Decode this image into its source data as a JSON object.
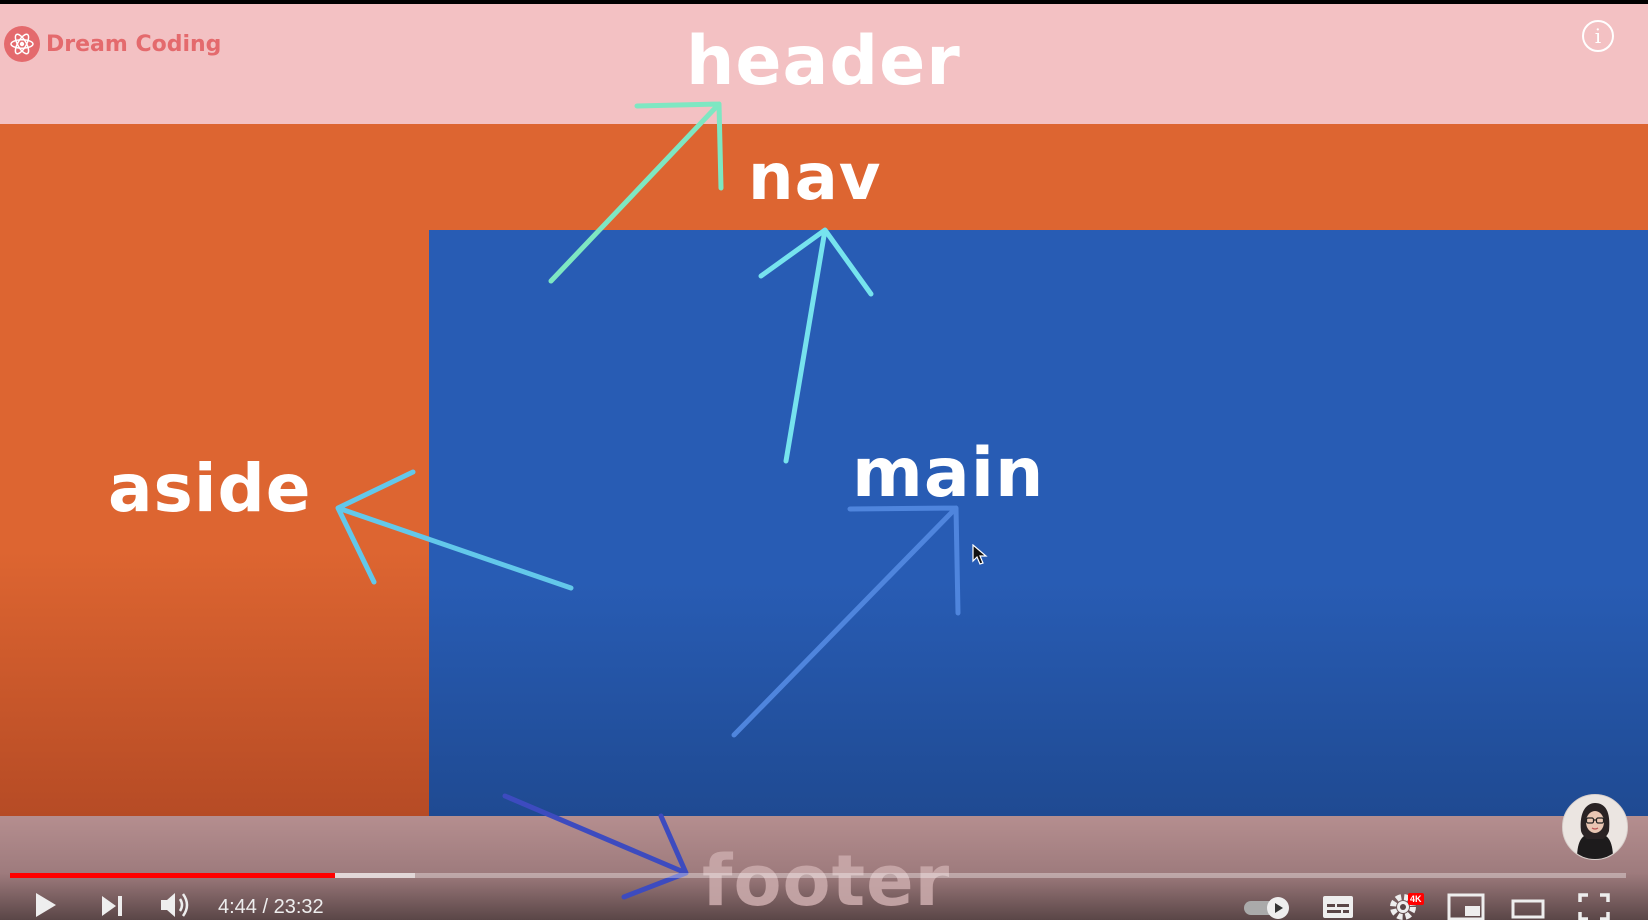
{
  "channel": {
    "name": "Dream Coding"
  },
  "slide": {
    "labels": {
      "header": "header",
      "nav": "nav",
      "aside": "aside",
      "main": "main",
      "footer": "footer"
    },
    "colors": {
      "header": "#f3c1c3",
      "nav": "#dd6531",
      "aside": "#dd6531",
      "main": "#285cb4",
      "footer": "#b58e8f"
    }
  },
  "player": {
    "time_current": "4:44",
    "time_separator": " / ",
    "time_total": "23:32",
    "played_fraction": 0.2013,
    "buffered_fraction": 0.2506,
    "settings_badge": "4K",
    "controls": [
      "play-icon",
      "next-icon",
      "volume-icon",
      "autoplay-toggle-icon",
      "subtitles-icon",
      "settings-icon",
      "miniplayer-icon",
      "theater-mode-icon",
      "fullscreen-icon"
    ]
  }
}
